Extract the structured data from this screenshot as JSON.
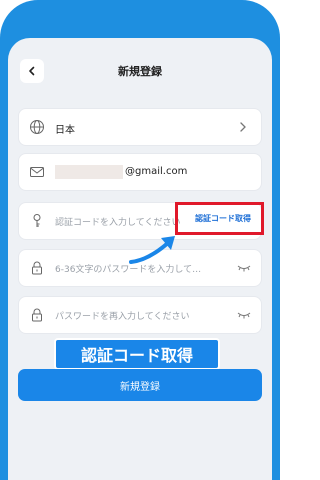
{
  "header": {
    "title": "新規登録",
    "back_icon": "chevron-left-icon"
  },
  "form": {
    "region": {
      "value": "日本",
      "icon": "globe-icon",
      "trailing_icon": "chevron-right-icon"
    },
    "email": {
      "value": "@gmail.com",
      "icon": "mail-icon"
    },
    "code": {
      "placeholder": "認証コードを入力してください",
      "icon": "key-icon",
      "action_label": "認証コード取得"
    },
    "password": {
      "placeholder": "6-36文字のパスワードを入力して…",
      "icon": "lock-icon",
      "trailing_icon": "eye-closed-icon"
    },
    "password_confirm": {
      "placeholder": "パスワードを再入力してください",
      "icon": "lock-icon",
      "trailing_icon": "eye-closed-icon"
    }
  },
  "annotation": {
    "caption": "認証コード取得",
    "highlight_color": "#e0192b",
    "arrow_color": "#1a86e8"
  },
  "submit_label": "新規登録",
  "colors": {
    "accent": "#1a86e8",
    "frame": "#1e8fe0",
    "background": "#eef1f5"
  }
}
